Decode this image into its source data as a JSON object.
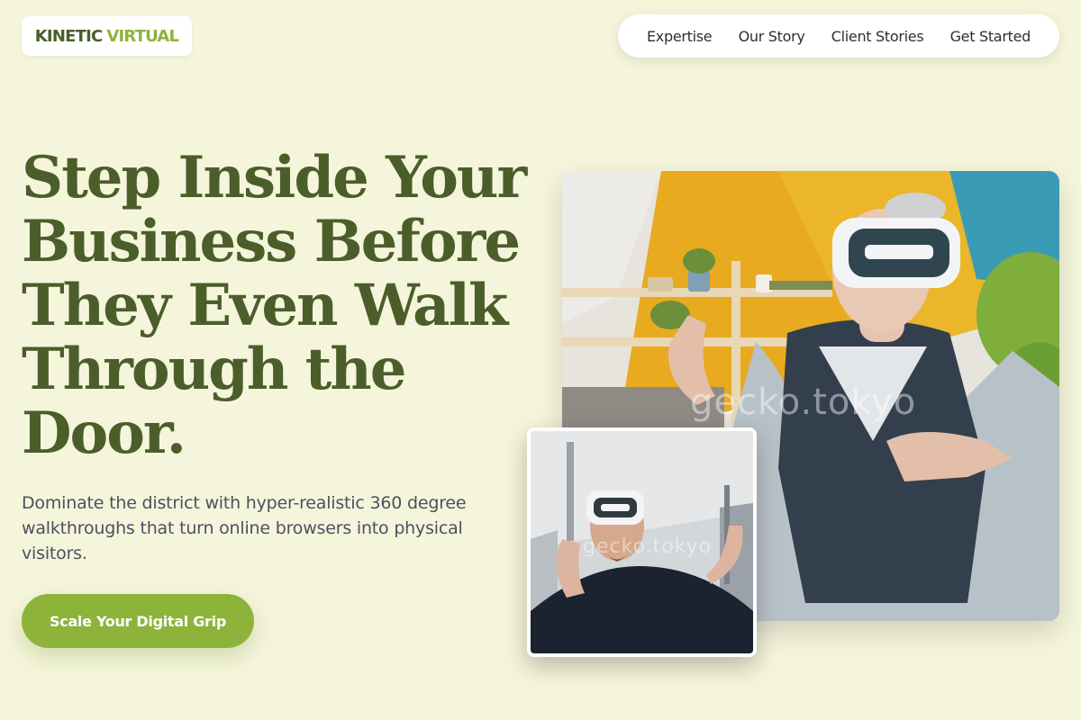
{
  "brand": {
    "part1": "KINETIC",
    "part2": "VIRTUAL"
  },
  "nav": {
    "items": [
      {
        "label": "Expertise"
      },
      {
        "label": "Our Story"
      },
      {
        "label": "Client Stories"
      },
      {
        "label": "Get Started"
      }
    ]
  },
  "hero": {
    "headline": "Step Inside Your Business Before They Even Walk Through the Door.",
    "subheadline": "Dominate the district with hyper-realistic 360 degree walkthroughs that turn online browsers into physical visitors.",
    "cta_label": "Scale Your Digital Grip"
  },
  "images": {
    "main_watermark": "gecko.tokyo",
    "small_watermark": "gecko.tokyo"
  },
  "colors": {
    "background": "#f5f5dc",
    "brand_dark": "#4b5e2a",
    "brand_accent": "#8db33a",
    "text_muted": "#4a5160"
  }
}
